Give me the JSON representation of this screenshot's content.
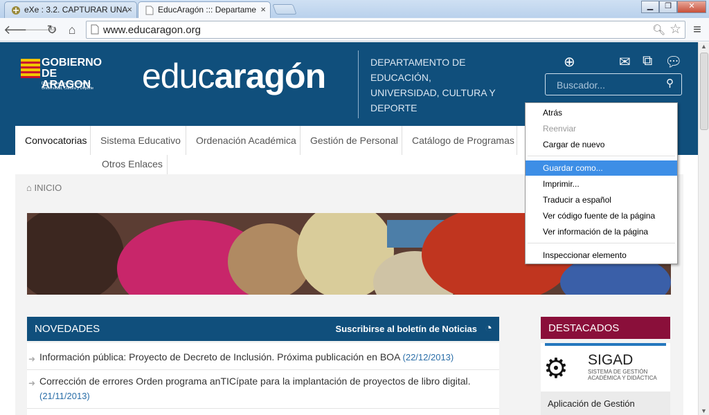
{
  "browser": {
    "tabs": [
      {
        "title": "eXe : 3.2. CAPTURAR UNA",
        "close": "×"
      },
      {
        "title": "EducAragón ::: Departame",
        "close": "×"
      }
    ],
    "url": "www.educaragon.org"
  },
  "site": {
    "logo": {
      "name": "GOBIERNO DE ARAGON",
      "sub": "Departamento de Educación, Universidad, Cultura y Deporte"
    },
    "brand_light": "educ",
    "brand_bold": "aragón",
    "department": "DEPARTAMENTO DE EDUCACIÓN, UNIVERSIDAD, CULTURA Y DEPORTE",
    "search_placeholder": "Buscador...",
    "menu": [
      "Convocatorias",
      "Sistema Educativo",
      "Ordenación Académica",
      "Gestión de Personal",
      "Catálogo de Programas",
      "Otros Enlaces"
    ],
    "breadcrumb": "INICIO",
    "news": {
      "title": "NOVEDADES",
      "subscribe": "Suscribirse al boletín de Noticias",
      "items": [
        {
          "text": "Información pública: Proyecto de Decreto de Inclusión. Próxima publicación en BOA",
          "date": "(22/12/2013)"
        },
        {
          "text": "Corrección de errores Orden programa anTICípate para la implantación de proyectos de libro digital.",
          "date": "(21/11/2013)"
        }
      ]
    },
    "featured": {
      "title": "DESTACADOS",
      "sigad_title": "SIGAD",
      "sigad_sub": "SISTEMA DE GESTIÓN ACADÉMICA Y DIDÁCTICA",
      "caption": "Aplicación de Gestión"
    }
  },
  "context_menu": {
    "items": [
      "Atrás",
      "Reenviar",
      "Cargar de nuevo",
      "Guardar como...",
      "Imprimir...",
      "Traducir a español",
      "Ver código fuente de la página",
      "Ver información de la página",
      "Inspeccionar elemento"
    ],
    "disabled": "Reenviar",
    "highlighted": "Guardar como..."
  }
}
